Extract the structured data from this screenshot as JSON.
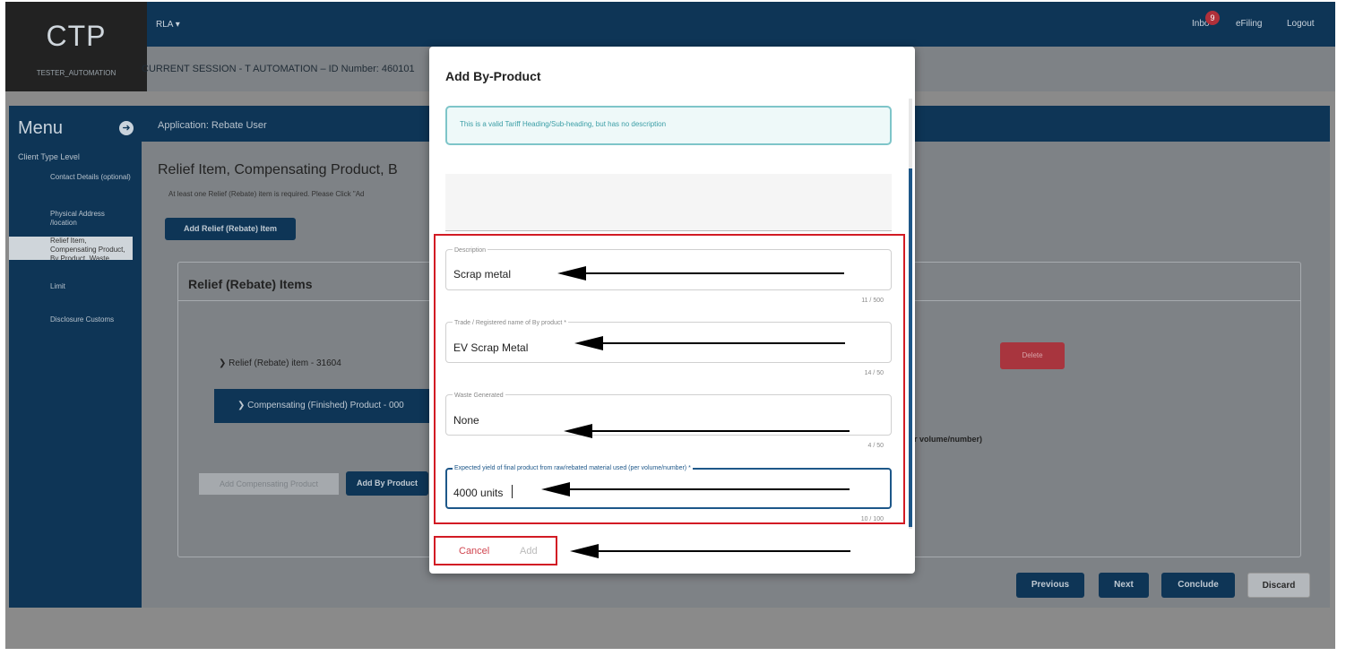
{
  "header": {
    "logo": "CTP",
    "user": "TESTER_AUTOMATION",
    "menu_dropdown": "RLA",
    "inbox_label": "Inbo",
    "inbox_count": "9",
    "efiling": "eFiling",
    "logout": "Logout",
    "session": "CURRENT SESSION - T AUTOMATION – ID Number: 460101"
  },
  "sidebar": {
    "title": "Menu",
    "section": "Client Type Level",
    "items": [
      {
        "label": "Contact Details (optional)"
      },
      {
        "label": "Physical Address /location"
      },
      {
        "label": "Relief Item, Compensating Product, By Product, Waste"
      },
      {
        "label": "Limit"
      },
      {
        "label": "Disclosure Customs"
      }
    ]
  },
  "main": {
    "app_label": "Application: Rebate User",
    "page_title": "Relief Item, Compensating Product, B",
    "hint": "At least one Relief (Rebate) item is required. Please Click \"Ad",
    "add_relief_button": "Add Relief (Rebate) Item",
    "panel_title": "Relief (Rebate) Items",
    "tree_item": "Relief (Rebate) item - 31604",
    "tree_sub_item": "Compensating (Finished) Product - 000",
    "add_compensating_button": "Add Compensating Product",
    "add_by_product_button": "Add By Product",
    "delete_button": "Delete",
    "volume_text": "r volume/number)",
    "previous_button": "Previous",
    "next_button": "Next",
    "conclude_button": "Conclude",
    "discard_button": "Discard"
  },
  "modal": {
    "title": "Add By-Product",
    "info": "This is a valid Tariff Heading/Sub-heading, but has no description",
    "fields": [
      {
        "label": "Description",
        "value": "Scrap metal",
        "counter": "11 / 500"
      },
      {
        "label": "Trade / Registered name of By product *",
        "value": "EV Scrap Metal",
        "counter": "14 / 50"
      },
      {
        "label": "Waste Generated",
        "value": "None",
        "counter": "4 / 50"
      },
      {
        "label": "Expected yield of final product from raw/rebated material used (per volume/number) *",
        "value": "4000 units",
        "counter": "10 / 100"
      }
    ],
    "cancel": "Cancel",
    "add": "Add"
  },
  "colors": {
    "navy": "#0e3556",
    "highlight_red": "#d21b24",
    "cancel_red": "#d0454f",
    "info_teal": "#3b9ea6"
  }
}
